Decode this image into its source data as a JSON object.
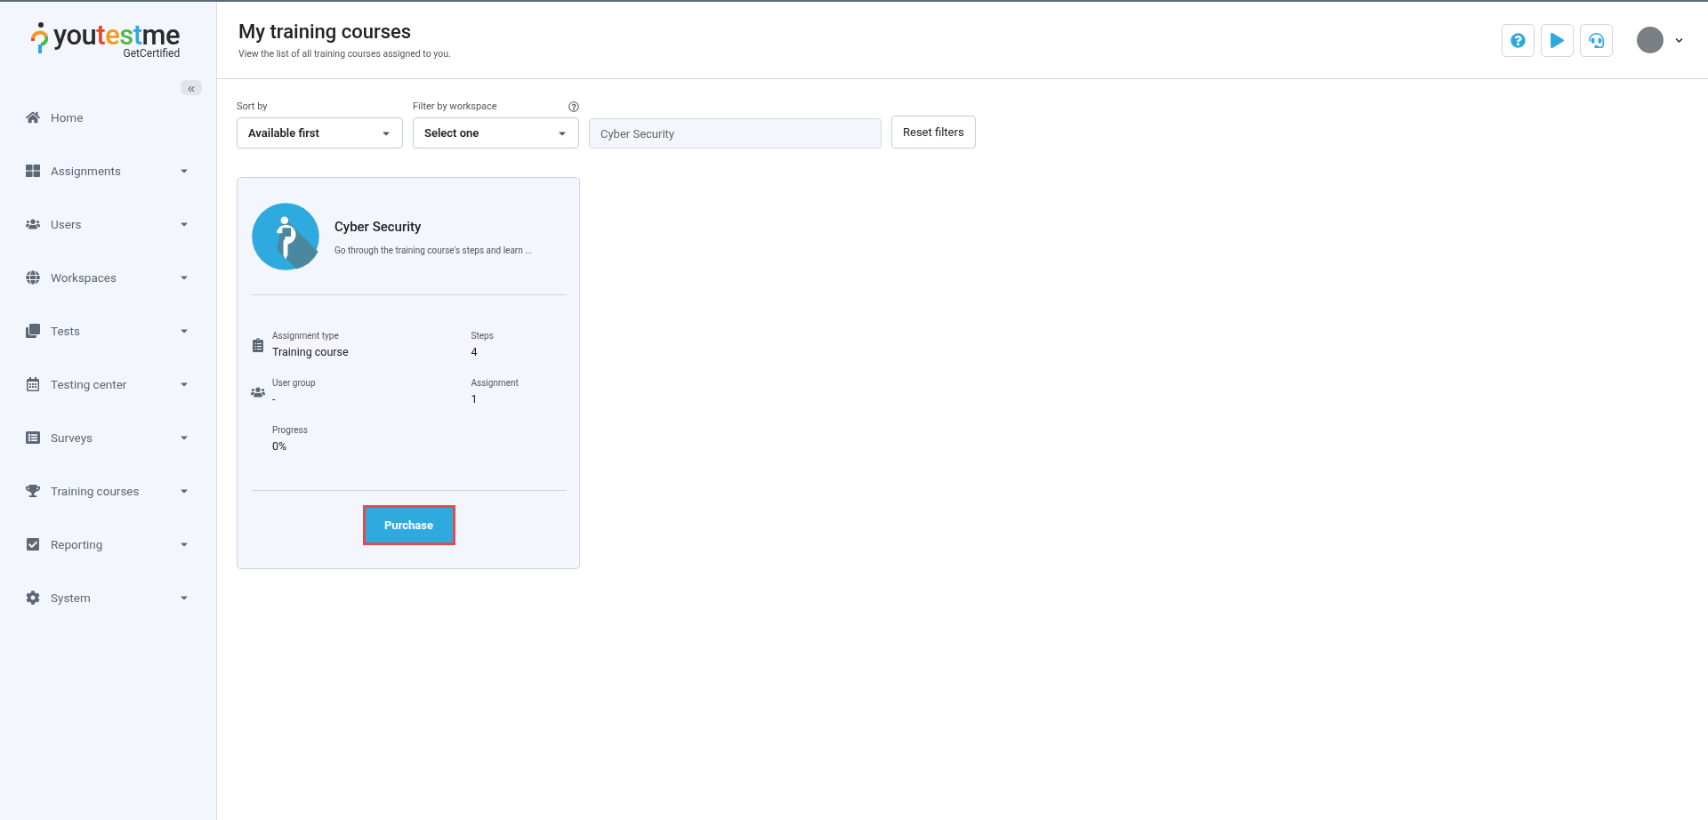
{
  "logo": {
    "word": "youtestme",
    "tagline": "GetCertified"
  },
  "sidebar": {
    "collapse_label": "«",
    "items": [
      {
        "label": "Home",
        "expandable": false
      },
      {
        "label": "Assignments",
        "expandable": true
      },
      {
        "label": "Users",
        "expandable": true
      },
      {
        "label": "Workspaces",
        "expandable": true
      },
      {
        "label": "Tests",
        "expandable": true
      },
      {
        "label": "Testing center",
        "expandable": true
      },
      {
        "label": "Surveys",
        "expandable": true
      },
      {
        "label": "Training courses",
        "expandable": true
      },
      {
        "label": "Reporting",
        "expandable": true
      },
      {
        "label": "System",
        "expandable": true
      }
    ]
  },
  "header": {
    "title": "My training courses",
    "subtitle": "View the list of all training courses assigned to you."
  },
  "filters": {
    "sort": {
      "label": "Sort by",
      "value": "Available first"
    },
    "workspace": {
      "label": "Filter by workspace",
      "value": "Select one"
    },
    "search": {
      "placeholder": "Cyber Security"
    },
    "reset_label": "Reset filters"
  },
  "courses": [
    {
      "title": "Cyber Security",
      "description": "Go through the training course's steps and learn ...",
      "fields": [
        {
          "label": "Assignment type",
          "value": "Training course"
        },
        {
          "label": "Steps",
          "value": "4"
        },
        {
          "label": "User group",
          "value": "-"
        },
        {
          "label": "Assignment",
          "value": "1"
        },
        {
          "label": "Progress",
          "value": "0%"
        }
      ],
      "action": {
        "label": "Purchase",
        "highlighted": true
      }
    }
  ]
}
